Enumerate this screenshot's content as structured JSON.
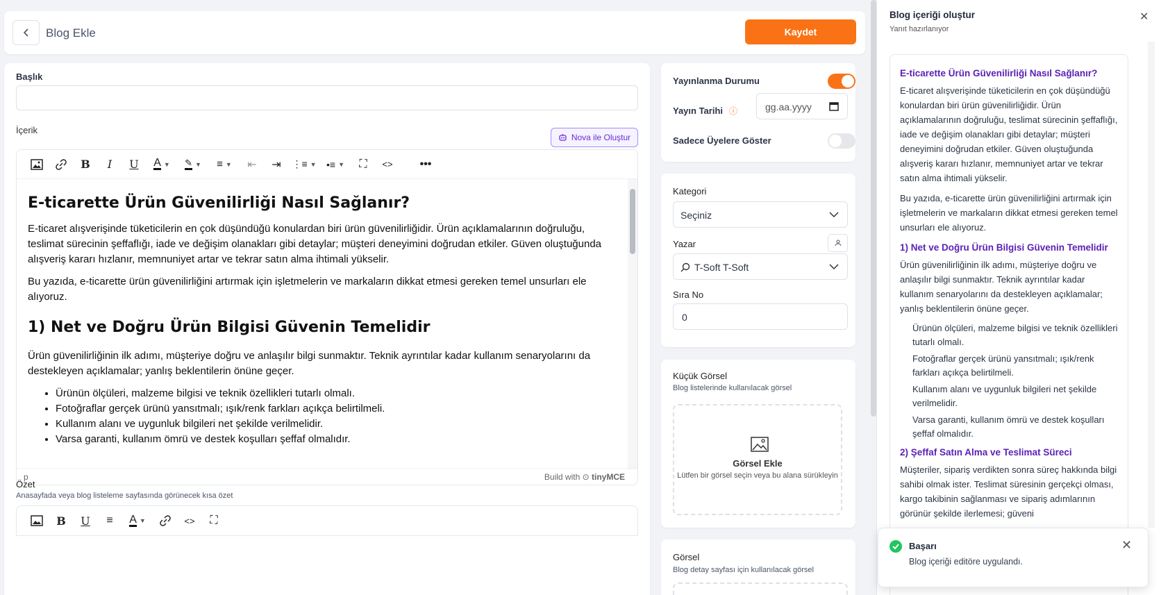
{
  "header": {
    "title": "Blog Ekle",
    "save_label": "Kaydet"
  },
  "form": {
    "title_label": "Başlık",
    "title_value": "",
    "content_label": "İçerik",
    "nova_button": "Nova ile Oluştur",
    "editor": {
      "h1": "E-ticarette Ürün Güvenilirliği Nasıl Sağlanır?",
      "p1": "E-ticaret alışverişinde tüketicilerin en çok düşündüğü konulardan biri ürün güvenilirliğidir. Ürün açıklamalarının doğruluğu, teslimat sürecinin şeffaflığı, iade ve değişim olanakları gibi detaylar; müşteri deneyimini doğrudan etkiler. Güven oluştuğunda alışveriş kararı hızlanır, memnuniyet artar ve tekrar satın alma ihtimali yükselir.",
      "p2": "Bu yazıda, e-ticarette ürün güvenilirliğini artırmak için işletmelerin ve markaların dikkat etmesi gereken temel unsurları ele alıyoruz.",
      "h2": "1) Net ve Doğru Ürün Bilgisi Güvenin Temelidir",
      "p3": "Ürün güvenilirliğinin ilk adımı, müşteriye doğru ve anlaşılır bilgi sunmaktır. Teknik ayrıntılar kadar kullanım senaryolarını da destekleyen açıklamalar; yanlış beklentilerin önüne geçer.",
      "bullets": [
        "Ürünün ölçüleri, malzeme bilgisi ve teknik özellikleri tutarlı olmalı.",
        "Fotoğraflar gerçek ürünü yansıtmalı; ışık/renk farkları açıkça belirtilmeli.",
        "Kullanım alanı ve uygunluk bilgileri net şekilde verilmelidir.",
        "Varsa garanti, kullanım ömrü ve destek koşulları şeffaf olmalıdır."
      ],
      "status_path": "p",
      "build_with": "Build with",
      "brand": "tinyMCE"
    },
    "summary_label": "Özet",
    "summary_hint": "Anasayfada veya blog listeleme sayfasında görünecek kısa özet"
  },
  "publish": {
    "status_label": "Yayınlanma Durumu",
    "status_on": true,
    "date_label": "Yayın Tarihi",
    "date_placeholder": "gg.aa.yyyy",
    "members_label": "Sadece Üyelere Göster",
    "members_on": false
  },
  "meta": {
    "category_label": "Kategori",
    "category_value": "Seçiniz",
    "author_label": "Yazar",
    "author_value": "T-Soft T-Soft",
    "order_label": "Sıra No",
    "order_value": "0"
  },
  "thumb": {
    "label": "Küçük Görsel",
    "hint": "Blog listelerinde kullanılacak görsel",
    "drop_title": "Görsel Ekle",
    "drop_hint": "Lütfen bir görsel seçin veya bu alana sürükleyin"
  },
  "image": {
    "label": "Görsel",
    "hint": "Blog detay sayfası için kullanılacak görsel"
  },
  "panel": {
    "title": "Blog içeriği oluştur",
    "subtitle": "Yanıt hazırlanıyor",
    "h1": "E-ticarette Ürün Güvenilirliği Nasıl Sağlanır?",
    "p1": "E-ticaret alışverişinde tüketicilerin en çok düşündüğü konulardan biri ürün güvenilirliğidir. Ürün açıklamalarının doğruluğu, teslimat sürecinin şeffaflığı, iade ve değişim olanakları gibi detaylar; müşteri deneyimini doğrudan etkiler. Güven oluştuğunda alışveriş kararı hızlanır, memnuniyet artar ve tekrar satın alma ihtimali yükselir.",
    "p2": "Bu yazıda, e-ticarette ürün güvenilirliğini artırmak için işletmelerin ve markaların dikkat etmesi gereken temel unsurları ele alıyoruz.",
    "h2": "1) Net ve Doğru Ürün Bilgisi Güvenin Temelidir",
    "p3": "Ürün güvenilirliğinin ilk adımı, müşteriye doğru ve anlaşılır bilgi sunmaktır. Teknik ayrıntılar kadar kullanım senaryolarını da destekleyen açıklamalar; yanlış beklentilerin önüne geçer.",
    "bullets": [
      "Ürünün ölçüleri, malzeme bilgisi ve teknik özellikleri tutarlı olmalı.",
      "Fotoğraflar gerçek ürünü yansıtmalı; ışık/renk farkları açıkça belirtilmeli.",
      "Kullanım alanı ve uygunluk bilgileri net şekilde verilmelidir.",
      "Varsa garanti, kullanım ömrü ve destek koşulları şeffaf olmalıdır."
    ],
    "h3": "2) Şeffaf Satın Alma ve Teslimat Süreci",
    "p4": "Müşteriler, sipariş verdikten sonra süreç hakkında bilgi sahibi olmak ister. Teslimat süresinin gerçekçi olması, kargo takibinin sağlanması ve sipariş adımlarının görünür şekilde ilerlemesi; güveni"
  },
  "toast": {
    "title": "Başarı",
    "message": "Blog içeriği editöre uygulandı."
  },
  "colors": {
    "accent": "#f97316",
    "ai_purple": "#5b21b6",
    "success": "#22c55e"
  }
}
